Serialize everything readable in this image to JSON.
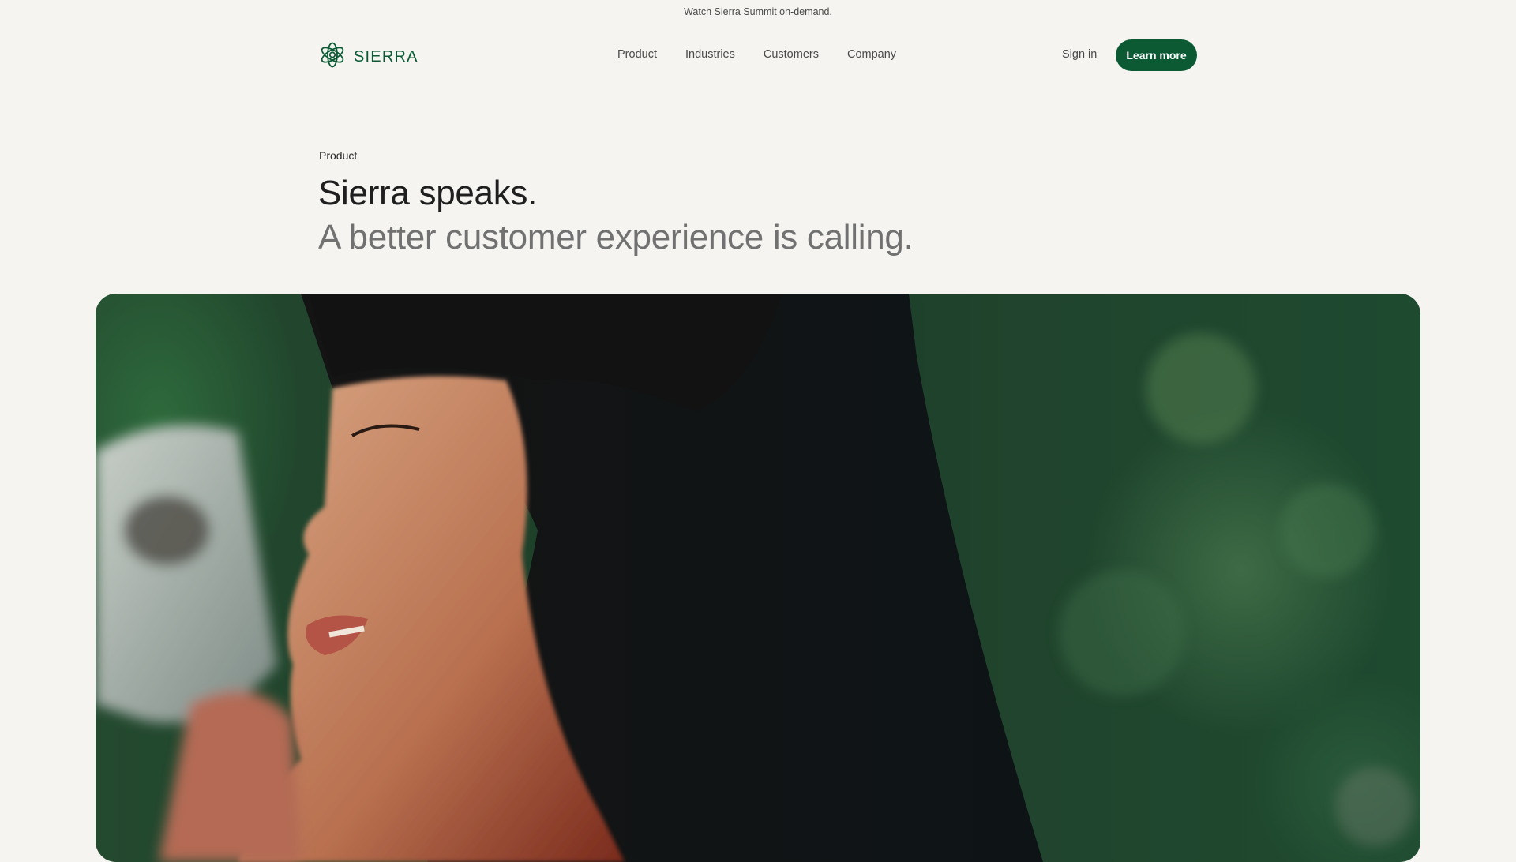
{
  "announcement": {
    "link_text": "Watch Sierra Summit on-demand",
    "suffix": "."
  },
  "header": {
    "brand": "SIERRA",
    "nav": [
      "Product",
      "Industries",
      "Customers",
      "Company"
    ],
    "sign_in": "Sign in",
    "cta": "Learn more"
  },
  "hero": {
    "eyebrow": "Product",
    "headline": "Sierra speaks.",
    "subheadline": "A better customer experience is calling."
  },
  "colors": {
    "brand_green": "#0b5a34",
    "background": "#f5f4f1"
  },
  "icons": {
    "logo": "flower-logo-icon"
  }
}
